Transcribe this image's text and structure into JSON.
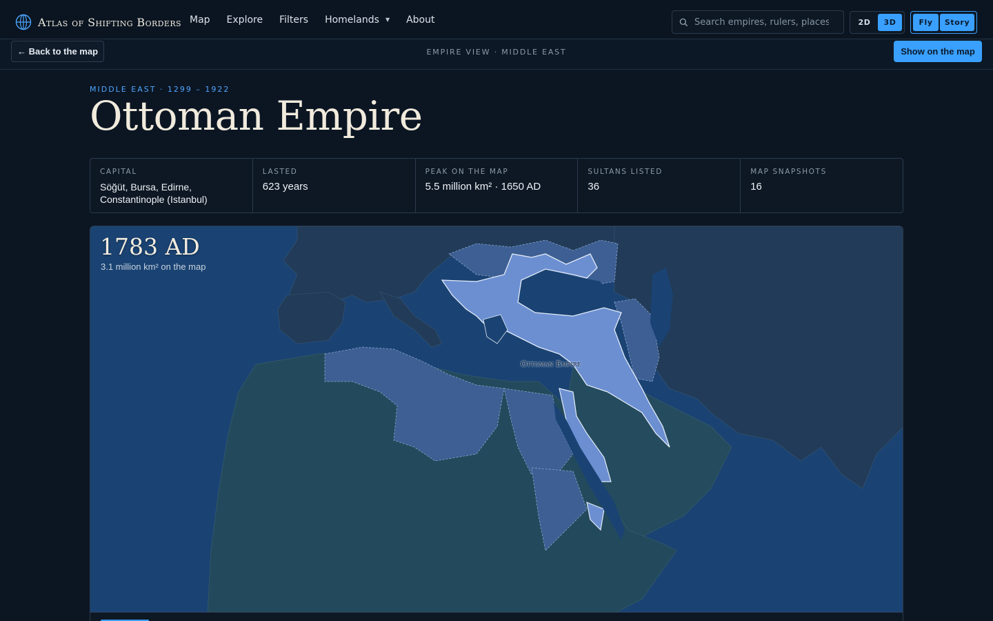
{
  "brand": {
    "name": "Atlas of Shifting Borders",
    "icon": "globe-icon"
  },
  "nav": {
    "links": [
      "Map",
      "Explore",
      "Filters",
      "Homelands",
      "About"
    ],
    "search_placeholder": "Search empires, rulers, places",
    "dimension_options": [
      "2D",
      "3D"
    ],
    "dimension_selected": "3D",
    "mode_options": [
      "Fly",
      "Story"
    ]
  },
  "subbar": {
    "back_label": "← Back to the map",
    "breadcrumb": "EMPIRE VIEW · MIDDLE EAST",
    "show_label": "Show on the map"
  },
  "empire": {
    "eyebrow": "MIDDLE EAST · 1299 – 1922",
    "name": "Ottoman Empire",
    "stats": [
      {
        "label": "Capital",
        "value": "Söğüt, Bursa, Edirne, Constantinople (Istanbul)"
      },
      {
        "label": "Lasted",
        "value": "623 years"
      },
      {
        "label": "Peak on the map",
        "value": "5.5 million km² · 1650 AD"
      },
      {
        "label": "Sultans listed",
        "value": "36"
      },
      {
        "label": "Map snapshots",
        "value": "16"
      }
    ]
  },
  "map": {
    "snapshot_year": "1783 AD",
    "snapshot_area": "3.1 million km² on the map",
    "territory_label": "Ottoman Empire",
    "colors": {
      "sea": "#1a4373",
      "land": "#1f3a56",
      "africa": "#234a5c",
      "ottoman": "#6b8fd1",
      "historic": "#3d5f93",
      "accent": "#3aa0ff"
    }
  }
}
